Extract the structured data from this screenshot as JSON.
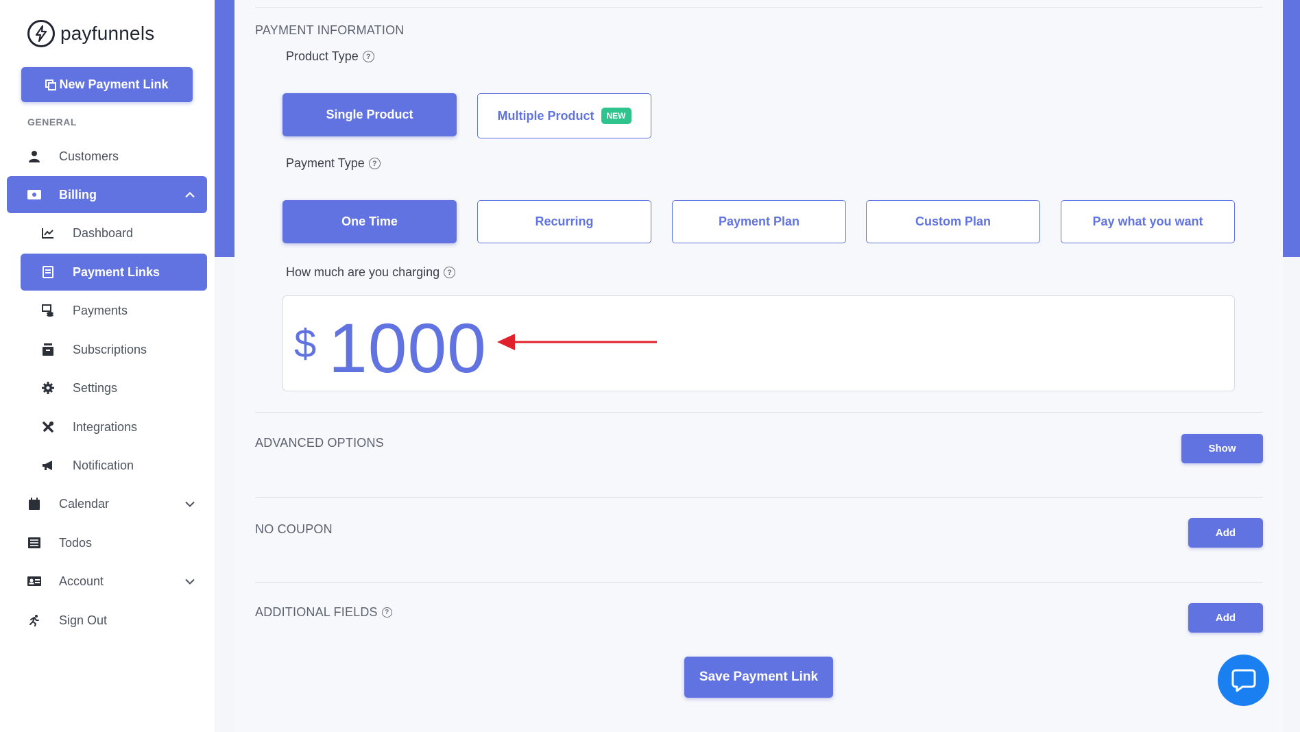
{
  "brand": {
    "name": "payfunnels"
  },
  "sidebar": {
    "new_link_label": "New Payment Link",
    "section_label": "GENERAL",
    "items": [
      {
        "label": "Customers",
        "icon": "user-icon"
      },
      {
        "label": "Billing",
        "icon": "money-icon"
      },
      {
        "label": "Dashboard",
        "icon": "chart-line-icon"
      },
      {
        "label": "Payment Links",
        "icon": "receipt-icon"
      },
      {
        "label": "Payments",
        "icon": "coins-icon"
      },
      {
        "label": "Subscriptions",
        "icon": "archive-icon"
      },
      {
        "label": "Settings",
        "icon": "gear-icon"
      },
      {
        "label": "Integrations",
        "icon": "tools-icon"
      },
      {
        "label": "Notification",
        "icon": "megaphone-icon"
      },
      {
        "label": "Calendar",
        "icon": "calendar-icon"
      },
      {
        "label": "Todos",
        "icon": "list-icon"
      },
      {
        "label": "Account",
        "icon": "id-card-icon"
      },
      {
        "label": "Sign Out",
        "icon": "running-icon"
      }
    ]
  },
  "payment_info": {
    "heading": "PAYMENT INFORMATION",
    "product_type_label": "Product Type",
    "product_types": [
      "Single Product",
      "Multiple Product"
    ],
    "new_badge": "NEW",
    "payment_type_label": "Payment Type",
    "payment_types": [
      "One Time",
      "Recurring",
      "Payment Plan",
      "Custom Plan",
      "Pay what you want"
    ],
    "charging_label": "How much are you charging",
    "currency": "$",
    "amount": "1000"
  },
  "advanced": {
    "heading": "ADVANCED OPTIONS",
    "button": "Show"
  },
  "coupon": {
    "heading": "NO COUPON",
    "button": "Add"
  },
  "additional": {
    "heading": "ADDITIONAL FIELDS",
    "button": "Add"
  },
  "save_label": "Save Payment Link",
  "colors": {
    "accent": "#6173e0",
    "badge": "#2fc38d",
    "chat": "#1a7ff0",
    "arrow": "#e0212b"
  }
}
